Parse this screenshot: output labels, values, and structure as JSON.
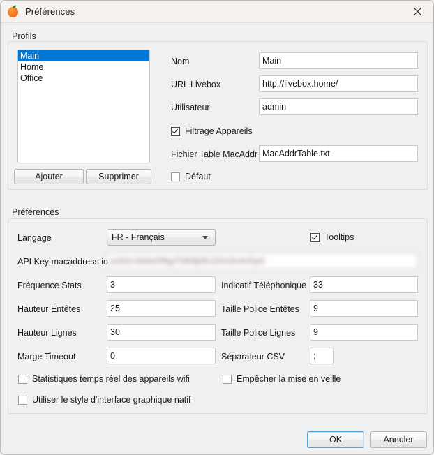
{
  "window": {
    "title": "Préférences",
    "app_icon": "orange-icon",
    "close_icon": "close-icon",
    "accent_color": "#0078d7",
    "background_color": "#f0f0f0",
    "titlebar_color": "#f6f2f0"
  },
  "profils": {
    "group_label": "Profils",
    "list": {
      "items": [
        "Main",
        "Home",
        "Office"
      ],
      "selected_index": 0
    },
    "buttons": {
      "add": "Ajouter",
      "remove": "Supprimer"
    },
    "fields": {
      "nom": {
        "label": "Nom",
        "value": "Main"
      },
      "url_livebox": {
        "label": "URL Livebox",
        "value": "http://livebox.home/"
      },
      "utilisateur": {
        "label": "Utilisateur",
        "value": "admin"
      },
      "fichier_table_macaddr": {
        "label": "Fichier Table MacAddr",
        "value": "MacAddrTable.txt"
      }
    },
    "checkboxes": {
      "filtrage_appareils": {
        "label": "Filtrage Appareils",
        "checked": true
      },
      "defaut": {
        "label": "Défaut",
        "checked": false
      }
    }
  },
  "preferences": {
    "group_label": "Préférences",
    "langage": {
      "label": "Langage",
      "value": "FR - Français",
      "dropdown_icon": "chevron-down-icon"
    },
    "api_key": {
      "label": "API Key macaddress.io",
      "value": "a1b2c3d4e5f6g7h8i9j0k1l2m3n4o5p6",
      "redacted": true
    },
    "fields_left": [
      {
        "label": "Fréquence Stats",
        "value": "3"
      },
      {
        "label": "Hauteur Entêtes",
        "value": "25"
      },
      {
        "label": "Hauteur Lignes",
        "value": "30"
      },
      {
        "label": "Marge Timeout",
        "value": "0"
      }
    ],
    "fields_right": [
      {
        "label": "Indicatif Téléphonique",
        "value": "33"
      },
      {
        "label": "Taille Police Entêtes",
        "value": "9"
      },
      {
        "label": "Taille Police Lignes",
        "value": "9"
      },
      {
        "label": "Séparateur CSV",
        "value": ";"
      }
    ],
    "checkboxes": {
      "tooltips": {
        "label": "Tooltips",
        "checked": true
      },
      "stats_temps_reel": {
        "label": "Statistiques temps réel des appareils wifi",
        "checked": false
      },
      "empecher_veille": {
        "label": "Empêcher la mise en veille",
        "checked": false
      },
      "style_natif": {
        "label": "Utiliser le style d'interface graphique natif",
        "checked": false
      }
    }
  },
  "footer": {
    "ok": "OK",
    "cancel": "Annuler"
  }
}
